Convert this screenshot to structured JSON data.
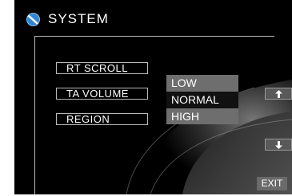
{
  "header": {
    "title": "SYSTEM",
    "icon": "disc-logo-icon"
  },
  "menu": {
    "items": [
      {
        "label": "RT  SCROLL"
      },
      {
        "label": "TA  VOLUME"
      },
      {
        "label": "REGION"
      }
    ]
  },
  "dropdown": {
    "options": [
      "LOW",
      "NORMAL",
      "HIGH"
    ],
    "selected": "NORMAL"
  },
  "controls": {
    "scroll_up_icon": "arrow-up-icon",
    "scroll_down_icon": "arrow-down-icon",
    "exit_label": "EXIT"
  },
  "colors": {
    "background": "#000000",
    "frame": "#b9b9b9",
    "option_bg": "#6e6e6e",
    "option_selected_bg": "#111111",
    "icon_blue": "#2f86d6"
  }
}
